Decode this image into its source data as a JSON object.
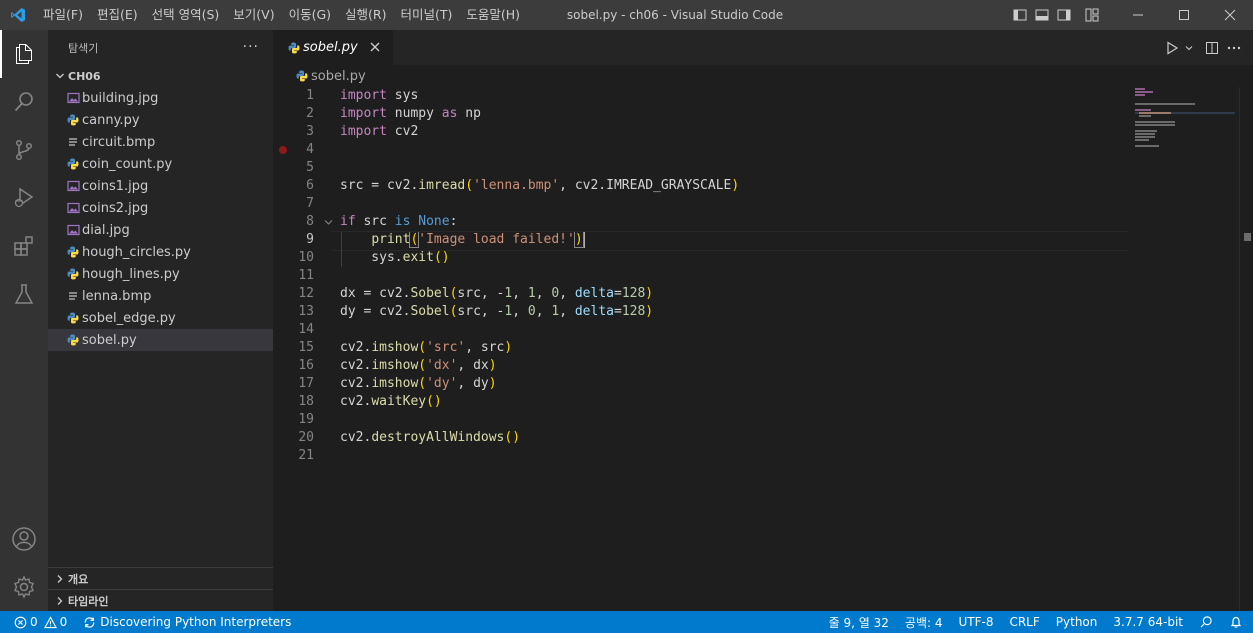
{
  "titlebar": {
    "menu": [
      "파일(F)",
      "편집(E)",
      "선택 영역(S)",
      "보기(V)",
      "이동(G)",
      "실행(R)",
      "터미널(T)",
      "도움말(H)"
    ],
    "title": "sobel.py - ch06 - Visual Studio Code"
  },
  "sidebar": {
    "header": "탐색기",
    "more": "···",
    "folder": "CH06",
    "files": [
      {
        "name": "building.jpg",
        "type": "image"
      },
      {
        "name": "canny.py",
        "type": "python"
      },
      {
        "name": "circuit.bmp",
        "type": "bmp"
      },
      {
        "name": "coin_count.py",
        "type": "python"
      },
      {
        "name": "coins1.jpg",
        "type": "image"
      },
      {
        "name": "coins2.jpg",
        "type": "image"
      },
      {
        "name": "dial.jpg",
        "type": "image"
      },
      {
        "name": "hough_circles.py",
        "type": "python"
      },
      {
        "name": "hough_lines.py",
        "type": "python"
      },
      {
        "name": "lenna.bmp",
        "type": "bmp"
      },
      {
        "name": "sobel_edge.py",
        "type": "python"
      },
      {
        "name": "sobel.py",
        "type": "python",
        "selected": true
      }
    ],
    "sections": [
      "개요",
      "타임라인"
    ]
  },
  "editor": {
    "tab": "sobel.py",
    "breadcrumb": "sobel.py",
    "line_numbers": [
      "1",
      "2",
      "3",
      "4",
      "5",
      "6",
      "7",
      "8",
      "9",
      "10",
      "11",
      "12",
      "13",
      "14",
      "15",
      "16",
      "17",
      "18",
      "19",
      "20",
      "21"
    ],
    "current_line": 9
  },
  "statusbar": {
    "errors": "0",
    "warnings": "0",
    "task": "Discovering Python Interpreters",
    "position": "줄 9, 열 32",
    "spaces": "공백: 4",
    "encoding": "UTF-8",
    "eol": "CRLF",
    "language": "Python",
    "interpreter": "3.7.7 64-bit"
  },
  "colors": {
    "statusbar": "#007acc",
    "keyword": "#c586c0",
    "string": "#ce9178",
    "number": "#b5cea8",
    "function": "#dcdcaa"
  }
}
